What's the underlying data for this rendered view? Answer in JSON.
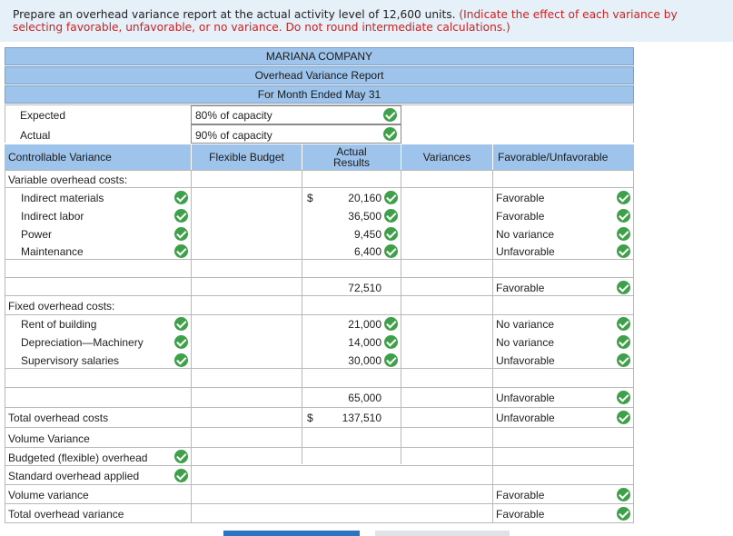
{
  "instructions": {
    "main": "Prepare an overhead variance report at the actual activity level of 12,600 units.",
    "note": "(Indicate the effect of each variance by selecting favorable, unfavorable, or no variance. Do not round intermediate calculations.)"
  },
  "report": {
    "company": "MARIANA COMPANY",
    "title": "Overhead Variance Report",
    "period": "For Month Ended May 31"
  },
  "capacity": {
    "expected_label": "Expected",
    "expected_value": "80% of capacity",
    "actual_label": "Actual",
    "actual_value": "90% of capacity"
  },
  "columns": {
    "controllable": "Controllable Variance",
    "flexible": "Flexible Budget",
    "actual": "Actual Results",
    "variances": "Variances",
    "favorable": "Favorable/Unfavorable"
  },
  "variable": {
    "heading": "Variable overhead costs:",
    "items": [
      {
        "label": "Indirect materials",
        "dollar": "$",
        "actual": "20,160",
        "effect": "Favorable"
      },
      {
        "label": "Indirect labor",
        "dollar": "",
        "actual": "36,500",
        "effect": "Favorable"
      },
      {
        "label": "Power",
        "dollar": "",
        "actual": "9,450",
        "effect": "No variance"
      },
      {
        "label": "Maintenance",
        "dollar": "",
        "actual": "6,400",
        "effect": "Unfavorable"
      }
    ],
    "total_actual": "72,510",
    "total_effect": "Favorable"
  },
  "fixed": {
    "heading": "Fixed overhead costs:",
    "items": [
      {
        "label": "Rent of building",
        "actual": "21,000",
        "effect": "No variance"
      },
      {
        "label": "Depreciation—Machinery",
        "actual": "14,000",
        "effect": "No variance"
      },
      {
        "label": "Supervisory salaries",
        "actual": "30,000",
        "effect": "Unfavorable"
      }
    ],
    "total_actual": "65,000",
    "total_effect": "Unfavorable"
  },
  "totals": {
    "label": "Total overhead costs",
    "dollar": "$",
    "actual": "137,510",
    "effect": "Unfavorable"
  },
  "volume": {
    "heading": "Volume Variance",
    "budgeted": "Budgeted (flexible) overhead",
    "standard": "Standard overhead applied",
    "variance_label": "Volume variance",
    "variance_effect": "Favorable",
    "total_label": "Total overhead variance",
    "total_effect": "Favorable"
  },
  "icons": {
    "check": "check-circle-icon",
    "check_color": "#3fa04a",
    "header_color": "#9ec4ec"
  }
}
